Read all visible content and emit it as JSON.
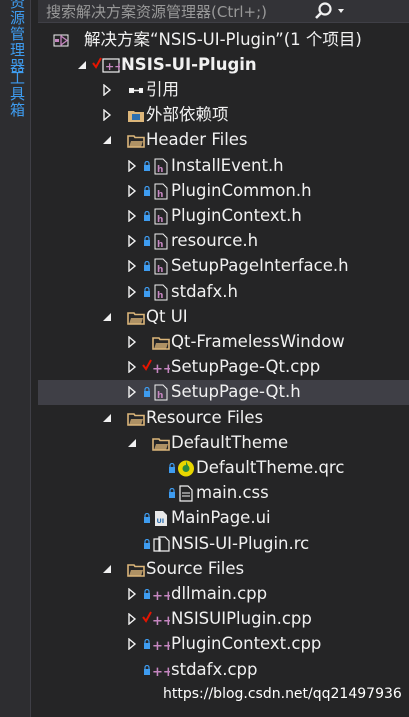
{
  "side_tabs": [
    "资源管理器",
    "工具箱"
  ],
  "search": {
    "placeholder": "搜索解决方案资源管理器(Ctrl+;)"
  },
  "tree": [
    {
      "label": "解决方案“NSIS-UI-Plugin”(1 个项目)",
      "icon": "solution-icon",
      "indent": 0,
      "arrow": "none",
      "lock": false,
      "check": false,
      "bold": false
    },
    {
      "label": "NSIS-UI-Plugin",
      "icon": "cpp-project-icon",
      "indent": 1,
      "arrow": "expanded",
      "lock": false,
      "check": true,
      "bold": true
    },
    {
      "label": "引用",
      "icon": "references-icon",
      "indent": 2,
      "arrow": "collapsed",
      "lock": false,
      "check": false,
      "bold": false
    },
    {
      "label": "外部依赖项",
      "icon": "external-deps-icon",
      "indent": 2,
      "arrow": "collapsed",
      "lock": false,
      "check": false,
      "bold": false
    },
    {
      "label": "Header Files",
      "icon": "filter-folder-icon",
      "indent": 2,
      "arrow": "expanded",
      "lock": false,
      "check": false,
      "bold": false
    },
    {
      "label": "InstallEvent.h",
      "icon": "header-file-icon",
      "indent": 3,
      "arrow": "collapsed",
      "lock": true,
      "check": false,
      "bold": false
    },
    {
      "label": "PluginCommon.h",
      "icon": "header-file-icon",
      "indent": 3,
      "arrow": "collapsed",
      "lock": true,
      "check": false,
      "bold": false
    },
    {
      "label": "PluginContext.h",
      "icon": "header-file-icon",
      "indent": 3,
      "arrow": "collapsed",
      "lock": true,
      "check": false,
      "bold": false
    },
    {
      "label": "resource.h",
      "icon": "header-file-icon",
      "indent": 3,
      "arrow": "collapsed",
      "lock": true,
      "check": false,
      "bold": false
    },
    {
      "label": "SetupPageInterface.h",
      "icon": "header-file-icon",
      "indent": 3,
      "arrow": "collapsed",
      "lock": true,
      "check": false,
      "bold": false
    },
    {
      "label": "stdafx.h",
      "icon": "header-file-icon",
      "indent": 3,
      "arrow": "collapsed",
      "lock": true,
      "check": false,
      "bold": false
    },
    {
      "label": "Qt UI",
      "icon": "filter-folder-icon",
      "indent": 2,
      "arrow": "expanded",
      "lock": false,
      "check": false,
      "bold": false
    },
    {
      "label": "Qt-FramelessWindow",
      "icon": "filter-folder-icon",
      "indent": 3,
      "arrow": "collapsed",
      "lock": false,
      "check": false,
      "bold": false
    },
    {
      "label": "SetupPage-Qt.cpp",
      "icon": "cpp-file-icon",
      "indent": 3,
      "arrow": "collapsed",
      "lock": false,
      "check": true,
      "bold": false
    },
    {
      "label": "SetupPage-Qt.h",
      "icon": "header-file-icon",
      "indent": 3,
      "arrow": "collapsed",
      "lock": true,
      "check": false,
      "bold": false,
      "selected": true
    },
    {
      "label": "Resource Files",
      "icon": "filter-folder-icon",
      "indent": 2,
      "arrow": "expanded",
      "lock": false,
      "check": false,
      "bold": false
    },
    {
      "label": "DefaultTheme",
      "icon": "filter-folder-icon",
      "indent": 3,
      "arrow": "expanded",
      "lock": false,
      "check": false,
      "bold": false
    },
    {
      "label": "DefaultTheme.qrc",
      "icon": "qrc-file-icon",
      "indent": 4,
      "arrow": "none",
      "lock": true,
      "check": false,
      "bold": false
    },
    {
      "label": "main.css",
      "icon": "css-file-icon",
      "indent": 4,
      "arrow": "none",
      "lock": true,
      "check": false,
      "bold": false
    },
    {
      "label": "MainPage.ui",
      "icon": "ui-file-icon",
      "indent": 3,
      "arrow": "none",
      "lock": true,
      "check": false,
      "bold": false
    },
    {
      "label": "NSIS-UI-Plugin.rc",
      "icon": "rc-file-icon",
      "indent": 3,
      "arrow": "none",
      "lock": true,
      "check": false,
      "bold": false
    },
    {
      "label": "Source Files",
      "icon": "filter-folder-icon",
      "indent": 2,
      "arrow": "expanded",
      "lock": false,
      "check": false,
      "bold": false
    },
    {
      "label": "dllmain.cpp",
      "icon": "cpp-file-icon",
      "indent": 3,
      "arrow": "collapsed",
      "lock": true,
      "check": false,
      "bold": false
    },
    {
      "label": "NSISUIPlugin.cpp",
      "icon": "cpp-file-icon",
      "indent": 3,
      "arrow": "collapsed",
      "lock": false,
      "check": true,
      "bold": false
    },
    {
      "label": "PluginContext.cpp",
      "icon": "cpp-file-icon",
      "indent": 3,
      "arrow": "collapsed",
      "lock": true,
      "check": false,
      "bold": false
    },
    {
      "label": "stdafx.cpp",
      "icon": "cpp-file-icon",
      "indent": 3,
      "arrow": "none",
      "lock": true,
      "check": false,
      "bold": false
    }
  ],
  "watermark": "https://blog.csdn.net/qq21497936",
  "colors": {
    "background": "#252526",
    "selected_row": "#3f3f46",
    "accent": "#3e9cf0",
    "lock": "#3e9cf0",
    "check": "#e51400",
    "folder": "#dcb67a",
    "cpp": "#c586c0",
    "text": "#f1f1f1"
  }
}
